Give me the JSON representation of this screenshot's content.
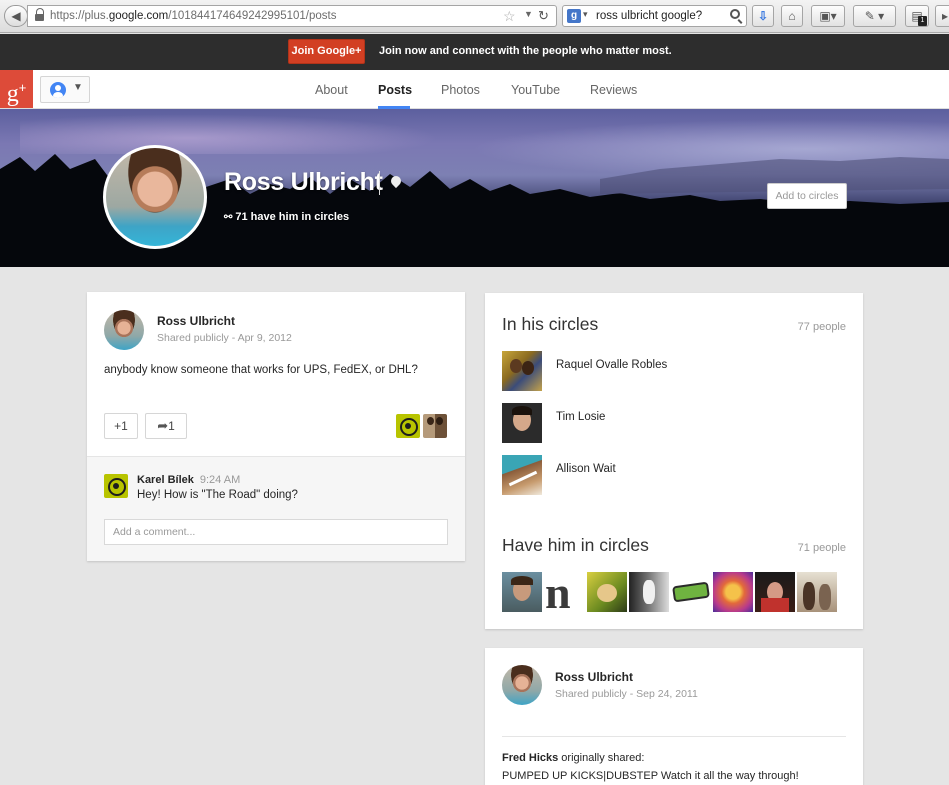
{
  "browser": {
    "url_prefix": "https://plus.",
    "url_domain": "google.com",
    "url_path": "/101844174649242995101/posts",
    "search_query": "ross ulbricht google?",
    "extension_badge": "1"
  },
  "promo": {
    "join_label": "Join Google+",
    "message": "Join now and connect with the people who matter most."
  },
  "nav": {
    "logo": "g",
    "logo_plus": "+",
    "tabs": [
      {
        "label": "About"
      },
      {
        "label": "Posts"
      },
      {
        "label": "Photos"
      },
      {
        "label": "YouTube"
      },
      {
        "label": "Reviews"
      }
    ],
    "active_tab": "Posts"
  },
  "profile": {
    "name": "Ross Ulbricht",
    "circles_text": "71 have him in circles",
    "add_to_circles": "Add to circles"
  },
  "post1": {
    "author": "Ross Ulbricht",
    "visibility": "Shared publicly",
    "separator": "-",
    "date": "Apr 9, 2012",
    "text": "anybody know someone that works for UPS, FedEX, or DHL?",
    "plus_one": "+1",
    "shares": "1",
    "comment": {
      "author": "Karel Bílek",
      "time": "9:24 AM",
      "text": "Hey! How is \"The Road\" doing?"
    },
    "comment_placeholder": "Add a comment..."
  },
  "in_circles": {
    "title": "In his circles",
    "count": "77 people",
    "people": [
      {
        "name": "Raquel Ovalle Robles"
      },
      {
        "name": "Tim Losie"
      },
      {
        "name": "Allison Wait"
      }
    ]
  },
  "have_him": {
    "title": "Have him in circles",
    "count": "71 people",
    "thumb_letter": "n"
  },
  "post2": {
    "author": "Ross Ulbricht",
    "visibility": "Shared publicly",
    "separator": "-",
    "date": "Sep 24, 2011",
    "original_author": "Fred Hicks",
    "original_suffix": " originally shared:",
    "text": "PUMPED UP KICKS|DUBSTEP Watch it all the way through!"
  },
  "colors": {
    "gplus_red": "#dd4b39",
    "join_button": "#d23f23",
    "active_tab_underline": "#4285f4"
  }
}
